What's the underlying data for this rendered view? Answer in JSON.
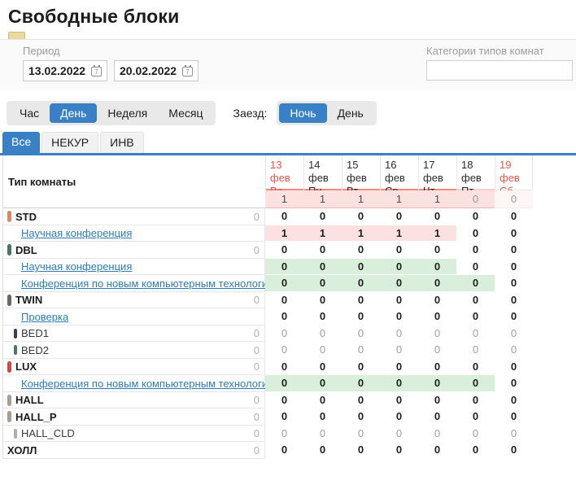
{
  "page": {
    "title": "Свободные блоки"
  },
  "filters": {
    "period_label": "Период",
    "date_from": "13.02.2022",
    "date_to": "20.02.2022",
    "category_label": "Категории типов комнат",
    "category_value": ""
  },
  "view_toggle": {
    "options": [
      "Час",
      "День",
      "Неделя",
      "Месяц"
    ],
    "active": "День"
  },
  "arrival": {
    "label": "Заезд:",
    "options": [
      "Ночь",
      "День"
    ],
    "active": "Ночь"
  },
  "tabs": {
    "items": [
      "Все",
      "НЕКУР",
      "ИНВ"
    ],
    "active": "Все"
  },
  "colors": {
    "accent_blue": "#3a80c5",
    "weekend_red": "#e0564c",
    "cell_pink": "#fbe2e0",
    "cell_green": "#d9efdc"
  },
  "table": {
    "type_column_header": "Тип комнаты",
    "columns": [
      {
        "date": "13 фев",
        "dow": "Вс",
        "weekend": true,
        "underline": "strong"
      },
      {
        "date": "14 фев",
        "dow": "Пн",
        "weekend": false,
        "underline": "strong"
      },
      {
        "date": "15 фев",
        "dow": "Вт",
        "weekend": false,
        "underline": "strong"
      },
      {
        "date": "16 фев",
        "dow": "Ср",
        "weekend": false,
        "underline": "strong"
      },
      {
        "date": "17 фев",
        "dow": "Чт",
        "weekend": false,
        "underline": "strong"
      },
      {
        "date": "18 фев",
        "dow": "Пт",
        "weekend": false,
        "underline": "light"
      },
      {
        "date": "19 фев",
        "dow": "Сб",
        "weekend": true,
        "underline": "none"
      }
    ],
    "summary_values": [
      "1",
      "1",
      "1",
      "1",
      "1",
      "0",
      "0"
    ],
    "summary_bg": [
      "pink",
      "pink",
      "pink",
      "pink",
      "pink",
      "pink",
      "none"
    ],
    "rows": [
      {
        "label": "STD",
        "kind": "type",
        "marker_color": "#dd8a63",
        "count": "0",
        "values": [
          "0",
          "0",
          "0",
          "0",
          "0",
          "0",
          "0"
        ],
        "cell_bg": [
          "",
          "",
          "",
          "",
          "",
          "",
          ""
        ]
      },
      {
        "label": "Научная конференция",
        "kind": "link",
        "marker_color": null,
        "count": null,
        "values": [
          "1",
          "1",
          "1",
          "1",
          "1",
          "0",
          "0"
        ],
        "cell_bg": [
          "pink",
          "pink",
          "pink",
          "pink",
          "pink",
          "",
          ""
        ]
      },
      {
        "label": "DBL",
        "kind": "type",
        "marker_color": "#4d7466",
        "count": "0",
        "values": [
          "0",
          "0",
          "0",
          "0",
          "0",
          "0",
          "0"
        ],
        "cell_bg": [
          "",
          "",
          "",
          "",
          "",
          "",
          ""
        ]
      },
      {
        "label": "Научная конференция",
        "kind": "link",
        "marker_color": null,
        "count": null,
        "values": [
          "0",
          "0",
          "0",
          "0",
          "0",
          "0",
          "0"
        ],
        "cell_bg": [
          "green",
          "green",
          "green",
          "green",
          "green",
          "",
          ""
        ]
      },
      {
        "label": "Конференция по новым компьютерным технологиям",
        "kind": "link",
        "marker_color": null,
        "count": null,
        "values": [
          "0",
          "0",
          "0",
          "0",
          "0",
          "0",
          "0"
        ],
        "cell_bg": [
          "green",
          "green",
          "green",
          "green",
          "green",
          "green",
          ""
        ]
      },
      {
        "label": "TWIN",
        "kind": "type",
        "marker_color": "#6f665c",
        "count": "0",
        "values": [
          "0",
          "0",
          "0",
          "0",
          "0",
          "0",
          "0"
        ],
        "cell_bg": [
          "",
          "",
          "",
          "",
          "",
          "",
          ""
        ]
      },
      {
        "label": "Проверка",
        "kind": "link",
        "marker_color": null,
        "count": null,
        "values": [
          "0",
          "0",
          "0",
          "0",
          "0",
          "0",
          "0"
        ],
        "cell_bg": [
          "",
          "",
          "",
          "",
          "",
          "",
          ""
        ]
      },
      {
        "label": "BED1",
        "kind": "sub",
        "marker_color": "#33405a",
        "count": "0",
        "muted": true,
        "values": [
          "0",
          "0",
          "0",
          "0",
          "0",
          "0",
          "0"
        ],
        "cell_bg": [
          "",
          "",
          "",
          "",
          "",
          "",
          ""
        ]
      },
      {
        "label": "BED2",
        "kind": "sub",
        "marker_color": "#4d7466",
        "count": "0",
        "muted": true,
        "values": [
          "0",
          "0",
          "0",
          "0",
          "0",
          "0",
          "0"
        ],
        "cell_bg": [
          "",
          "",
          "",
          "",
          "",
          "",
          ""
        ]
      },
      {
        "label": "LUX",
        "kind": "type",
        "marker_color": "#cf4944",
        "count": "0",
        "values": [
          "0",
          "0",
          "0",
          "0",
          "0",
          "0",
          "0"
        ],
        "cell_bg": [
          "",
          "",
          "",
          "",
          "",
          "",
          ""
        ]
      },
      {
        "label": "Конференция по новым компьютерным технологиям",
        "kind": "link",
        "marker_color": null,
        "count": null,
        "values": [
          "0",
          "0",
          "0",
          "0",
          "0",
          "0",
          "0"
        ],
        "cell_bg": [
          "green",
          "green",
          "green",
          "green",
          "green",
          "green",
          ""
        ]
      },
      {
        "label": "HALL",
        "kind": "type",
        "marker_color": "#a89f92",
        "count": "0",
        "values": [
          "0",
          "0",
          "0",
          "0",
          "0",
          "0",
          "0"
        ],
        "cell_bg": [
          "",
          "",
          "",
          "",
          "",
          "",
          ""
        ]
      },
      {
        "label": "HALL_P",
        "kind": "type",
        "marker_color": "#a89f92",
        "count": "0",
        "values": [
          "0",
          "0",
          "0",
          "0",
          "0",
          "0",
          "0"
        ],
        "cell_bg": [
          "",
          "",
          "",
          "",
          "",
          "",
          ""
        ]
      },
      {
        "label": "HALL_CLD",
        "kind": "sub",
        "marker_color": "#b5ad9f",
        "count": "0",
        "muted": true,
        "values": [
          "0",
          "0",
          "0",
          "0",
          "0",
          "0",
          "0"
        ],
        "cell_bg": [
          "",
          "",
          "",
          "",
          "",
          "",
          ""
        ]
      },
      {
        "label": "ХОЛЛ",
        "kind": "type",
        "marker_color": null,
        "count": "0",
        "values": [
          "0",
          "0",
          "0",
          "0",
          "0",
          "0",
          "0"
        ],
        "cell_bg": [
          "",
          "",
          "",
          "",
          "",
          "",
          ""
        ]
      }
    ]
  }
}
